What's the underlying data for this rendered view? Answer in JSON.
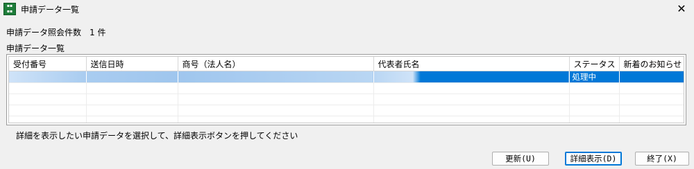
{
  "window": {
    "title": "申請データ一覧",
    "icon": "app-document-icon",
    "close_glyph": "✕"
  },
  "summary": {
    "count_label": "申請データ照会件数　1 件"
  },
  "list": {
    "title": "申請データ一覧",
    "columns": [
      "受付番号",
      "送信日時",
      "商号（法人名）",
      "代表者氏名",
      "ステータス",
      "新着のお知らせ"
    ],
    "rows": [
      {
        "status": "処理中",
        "notice": ""
      }
    ]
  },
  "hint": "詳細を表示したい申請データを選択して、詳細表示ボタンを押してください",
  "buttons": {
    "refresh": "更新(U)",
    "detail": "詳細表示(D)",
    "close": "終了(X)"
  },
  "colors": {
    "selection": "#0078d7",
    "icon_green": "#1e7d3a"
  }
}
